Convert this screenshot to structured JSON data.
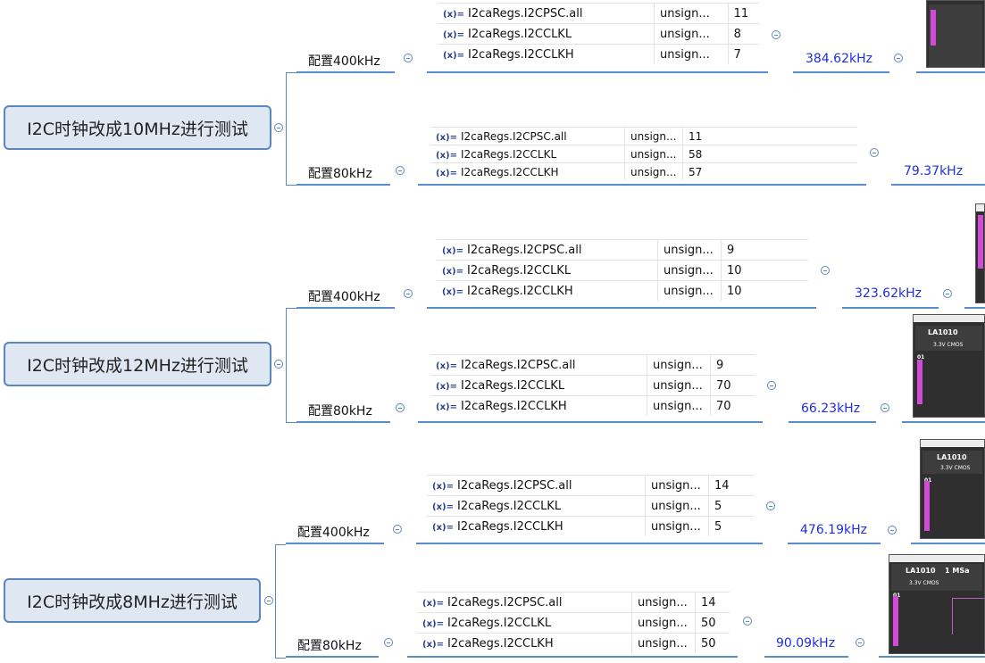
{
  "symbols": {
    "var_icon": "(x)=",
    "collapse_icon": "circle-minus-icon"
  },
  "colors": {
    "topic_border": "#5c86bf",
    "topic_fill": "#dfe7f2",
    "frequency_text": "#1f2ee0",
    "connector": "#5c86bf"
  },
  "groups": [
    {
      "topic": "I2C时钟改成10MHz进行测试",
      "configs": [
        {
          "label": "配置400kHz",
          "vars": [
            {
              "name": "I2caRegs.I2CPSC.all",
              "type": "unsign...",
              "value": "11"
            },
            {
              "name": "I2caRegs.I2CCLKL",
              "type": "unsign...",
              "value": "8"
            },
            {
              "name": "I2caRegs.I2CCLKH",
              "type": "unsign...",
              "value": "7"
            }
          ],
          "result": "384.62kHz"
        },
        {
          "label": "配置80kHz",
          "vars": [
            {
              "name": "I2caRegs.I2CPSC.all",
              "type": "unsign...",
              "value": "11"
            },
            {
              "name": "I2caRegs.I2CCLKL",
              "type": "unsign...",
              "value": "58"
            },
            {
              "name": "I2caRegs.I2CCLKH",
              "type": "unsign...",
              "value": "57"
            }
          ],
          "result": "79.37kHz"
        }
      ]
    },
    {
      "topic": "I2C时钟改成12MHz进行测试",
      "configs": [
        {
          "label": "配置400kHz",
          "vars": [
            {
              "name": "I2caRegs.I2CPSC.all",
              "type": "unsign...",
              "value": "9"
            },
            {
              "name": "I2caRegs.I2CCLKL",
              "type": "unsign...",
              "value": "10"
            },
            {
              "name": "I2caRegs.I2CCLKH",
              "type": "unsign...",
              "value": "10"
            }
          ],
          "result": "323.62kHz"
        },
        {
          "label": "配置80kHz",
          "vars": [
            {
              "name": "I2caRegs.I2CPSC.all",
              "type": "unsign...",
              "value": "9"
            },
            {
              "name": "I2caRegs.I2CCLKL",
              "type": "unsign...",
              "value": "70"
            },
            {
              "name": "I2caRegs.I2CCLKH",
              "type": "unsign...",
              "value": "70"
            }
          ],
          "result": "66.23kHz"
        }
      ]
    },
    {
      "topic": "I2C时钟改成8MHz进行测试",
      "configs": [
        {
          "label": "配置400kHz",
          "vars": [
            {
              "name": "I2caRegs.I2CPSC.all",
              "type": "unsign...",
              "value": "14"
            },
            {
              "name": "I2caRegs.I2CCLKL",
              "type": "unsign...",
              "value": "5"
            },
            {
              "name": "I2caRegs.I2CCLKH",
              "type": "unsign...",
              "value": "5"
            }
          ],
          "result": "476.19kHz"
        },
        {
          "label": "配置80kHz",
          "vars": [
            {
              "name": "I2caRegs.I2CPSC.all",
              "type": "unsign...",
              "value": "14"
            },
            {
              "name": "I2caRegs.I2CCLKL",
              "type": "unsign...",
              "value": "50"
            },
            {
              "name": "I2caRegs.I2CCLKH",
              "type": "unsign...",
              "value": "50"
            }
          ],
          "result": "90.09kHz"
        }
      ]
    }
  ],
  "analyzer": {
    "model": "LA1010",
    "sample_rate": "1 MSa",
    "voltage": "3.3V CMOS",
    "channel": "01"
  }
}
